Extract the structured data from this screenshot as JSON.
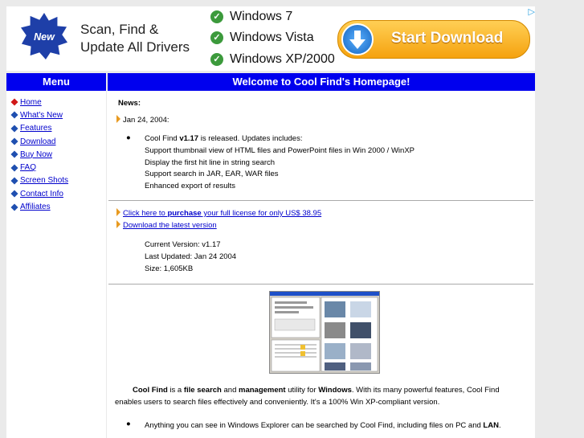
{
  "ad": {
    "badge": "New",
    "headline_1": "Scan, Find &",
    "headline_2": "Update All Drivers",
    "os_1": "Windows 7",
    "os_2": "Windows Vista",
    "os_3": "Windows XP/2000",
    "button": "Start Download"
  },
  "menu": {
    "title": "Menu",
    "items": [
      "Home",
      "What's New",
      "Features",
      "Download",
      "Buy Now",
      "FAQ",
      "Screen Shots",
      "Contact Info",
      "Affiliates"
    ]
  },
  "header": {
    "title": "Welcome to Cool Find's Homepage!"
  },
  "news": {
    "label": "News:",
    "date": "Jan 24, 2004:",
    "release_pre": "Cool Find ",
    "release_version": "v1.17",
    "release_post": " is released. Updates includes:",
    "updates": [
      "Support thumbnail view of HTML files and PowerPoint files in Win 2000 / WinXP",
      "Display the first hit line in string search",
      "Support search in JAR, EAR, WAR files",
      "Enhanced export of results"
    ]
  },
  "purchase": {
    "pre": "Click here to ",
    "bold": "purchase",
    "post": " your full license for only US$ 38.95",
    "download": "Download the latest version"
  },
  "version": {
    "current": "Current Version: v1.17",
    "updated": "Last Updated: Jan 24 2004",
    "size": "Size: 1,605KB"
  },
  "intro": {
    "a": "Cool Find",
    "b": " is a ",
    "c": "file search",
    "d": " and ",
    "e": "management",
    "f": " utility for ",
    "g": "Windows",
    "h": ". With its many powerful features, Cool Find",
    "line2": "enables users to search files effectively and conveniently. It's a 100% Win XP-compliant version."
  },
  "feature": {
    "pre": "Anything you can see in Windows Explorer can be searched by Cool Find, including files on PC and ",
    "bold": "LAN",
    "post": "."
  }
}
